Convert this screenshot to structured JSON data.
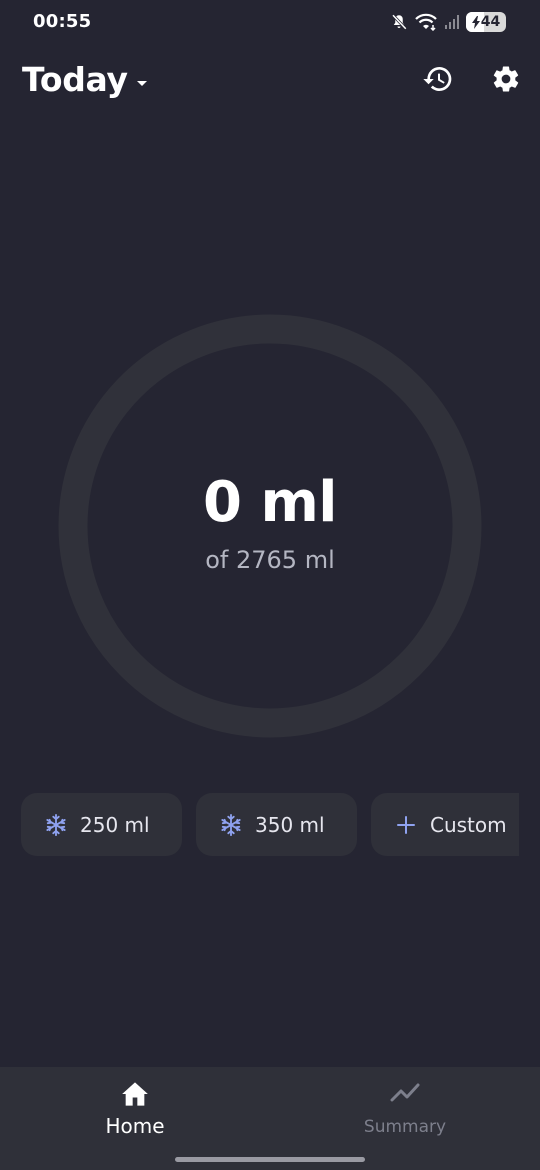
{
  "status_bar": {
    "time": "00:55",
    "battery_level": "44",
    "battery_percent": 0.44
  },
  "header": {
    "title": "Today",
    "icons": {
      "dropdown": "caret-down-icon",
      "history": "history-icon",
      "settings": "gear-icon"
    }
  },
  "progress": {
    "value_text": "0 ml",
    "goal_text": "of 2765 ml",
    "fraction": 0,
    "track_color": "#30313a"
  },
  "quick_add": [
    {
      "label": "250 ml",
      "icon": "snowflake-icon"
    },
    {
      "label": "350 ml",
      "icon": "snowflake-icon"
    },
    {
      "label": "Custom",
      "icon": "plus-icon"
    }
  ],
  "nav": {
    "home_label": "Home",
    "summary_label": "Summary",
    "active": "Home"
  },
  "colors": {
    "background": "#252532",
    "surface": "#2f3039",
    "accent": "#8fa2f0",
    "inactive": "#7d7f8c"
  }
}
